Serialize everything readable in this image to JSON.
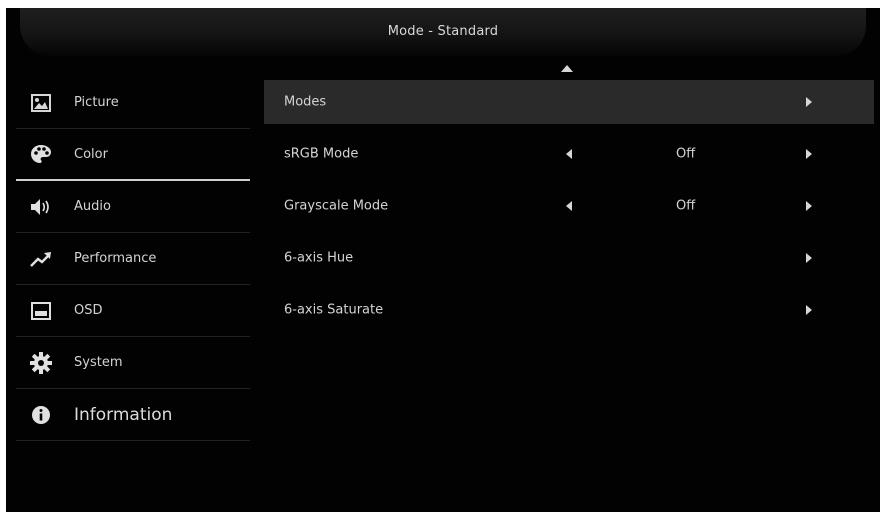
{
  "header": {
    "title": "Mode - Standard"
  },
  "sidebar": {
    "items": [
      {
        "label": "Picture",
        "icon": "picture-icon"
      },
      {
        "label": "Color",
        "icon": "palette-icon",
        "active": true
      },
      {
        "label": "Audio",
        "icon": "speaker-icon"
      },
      {
        "label": "Performance",
        "icon": "trend-icon"
      },
      {
        "label": "OSD",
        "icon": "osd-icon"
      },
      {
        "label": "System",
        "icon": "gear-icon"
      },
      {
        "label": "Information",
        "icon": "info-icon"
      }
    ]
  },
  "main": {
    "rows": [
      {
        "label": "Modes",
        "value": null,
        "selected": true
      },
      {
        "label": "sRGB Mode",
        "value": "Off"
      },
      {
        "label": "Grayscale Mode",
        "value": "Off"
      },
      {
        "label": "6-axis Hue",
        "value": null
      },
      {
        "label": "6-axis Saturate",
        "value": null
      }
    ]
  },
  "colors": {
    "background": "#020202",
    "text": "#d4d4d4",
    "selected_row": "#2a2a2a",
    "active_underline": "#cfcfcf"
  }
}
